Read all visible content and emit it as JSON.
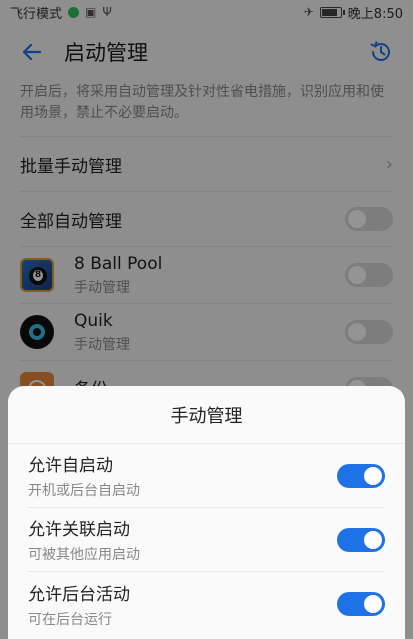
{
  "status_bar": {
    "left_text": "飞行模式",
    "time": "晚上8:50"
  },
  "header": {
    "title": "启动管理"
  },
  "description": "开启后，将采用自动管理及针对性省电措施，识别应用和使用场景，禁止不必要启动。",
  "list": {
    "batch_manual": "批量手动管理",
    "all_auto": "全部自动管理",
    "apps": [
      {
        "name": "8 Ball Pool",
        "status": "手动管理",
        "enabled": false
      },
      {
        "name": "Quik",
        "status": "手动管理",
        "enabled": false
      },
      {
        "name": "备份",
        "status": "",
        "enabled": false
      }
    ]
  },
  "sheet": {
    "title": "手动管理",
    "options": [
      {
        "label": "允许自启动",
        "sub": "开机或后台自启动",
        "enabled": true
      },
      {
        "label": "允许关联启动",
        "sub": "可被其他应用启动",
        "enabled": true
      },
      {
        "label": "允许后台活动",
        "sub": "可在后台运行",
        "enabled": true
      }
    ]
  },
  "colors": {
    "accent": "#1f72e6"
  }
}
